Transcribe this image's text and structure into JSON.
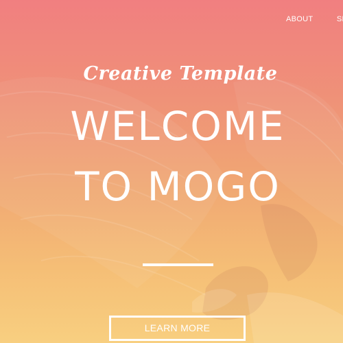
{
  "nav": {
    "items": [
      {
        "label": "ABOUT"
      },
      {
        "label": "SERVICE"
      }
    ]
  },
  "hero": {
    "tagline": "Creative Template",
    "title_line1": "WELCOME",
    "title_line2": "TO MOGO",
    "cta_label": "LEARN MORE",
    "background_image": "vulture-with-spread-wings"
  },
  "colors": {
    "gradient_top": "#f17f80",
    "gradient_bottom": "#f8cf80",
    "text": "#ffffff"
  }
}
